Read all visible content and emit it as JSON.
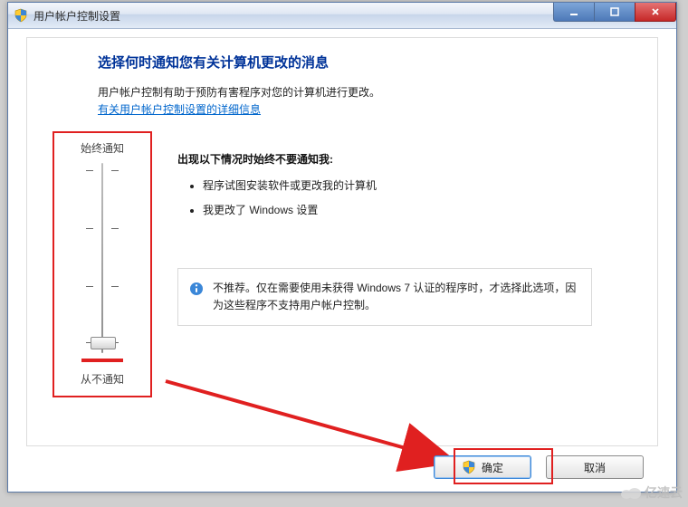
{
  "window": {
    "title": "用户帐户控制设置"
  },
  "heading": "选择何时通知您有关计算机更改的消息",
  "intro": "用户帐户控制有助于预防有害程序对您的计算机进行更改。",
  "link": "有关用户帐户控制设置的详细信息",
  "slider": {
    "top_label": "始终通知",
    "bottom_label": "从不通知",
    "ticks": 4,
    "thumb_index": 3
  },
  "right": {
    "subhead": "出现以下情况时始终不要通知我:",
    "bullets": [
      "程序试图安装软件或更改我的计算机",
      "我更改了 Windows 设置"
    ],
    "info": "不推荐。仅在需要使用未获得 Windows 7 认证的程序时，才选择此选项，因为这些程序不支持用户帐户控制。"
  },
  "buttons": {
    "ok": "确定",
    "cancel": "取消"
  },
  "watermark": "亿速云"
}
